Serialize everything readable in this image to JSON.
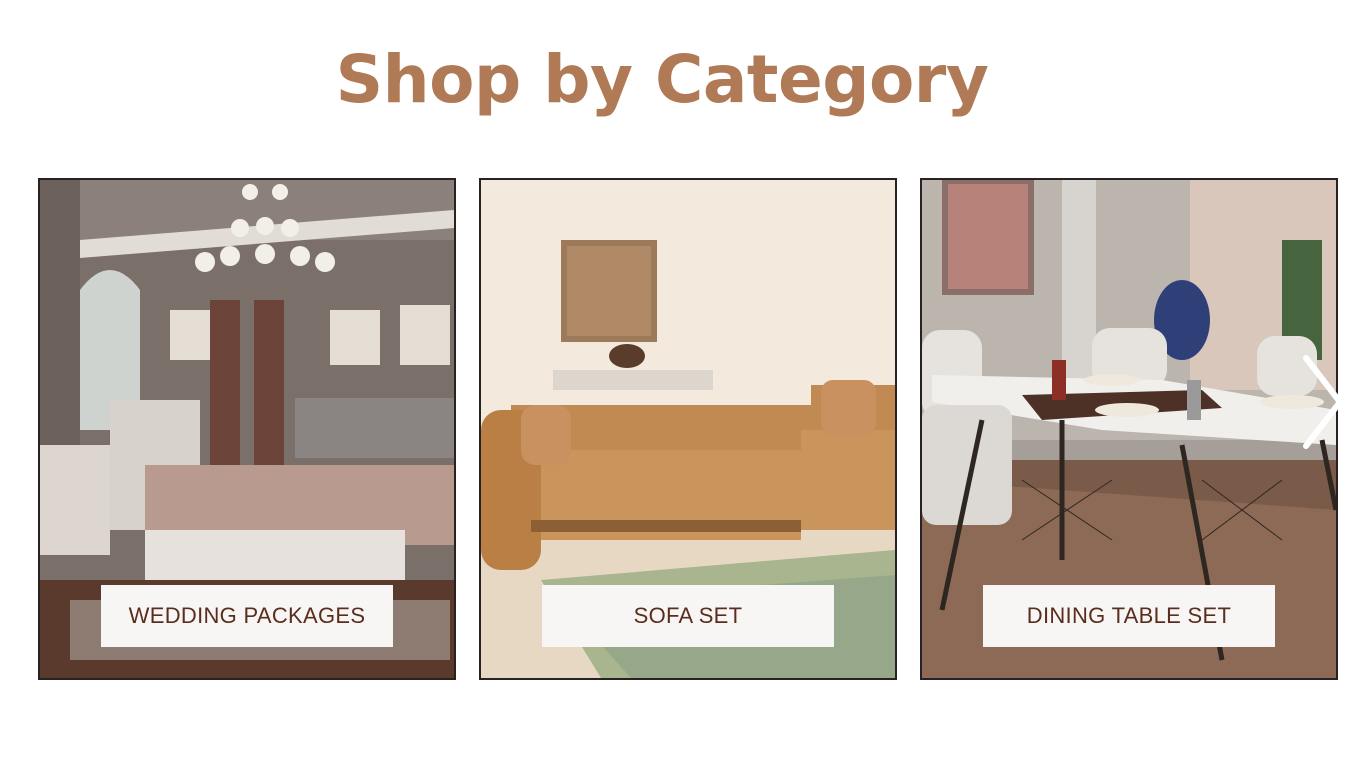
{
  "heading": {
    "title": "Shop by Category",
    "color": "#b07a56"
  },
  "categories": [
    {
      "label": "WEDDING PACKAGES",
      "image": "bedroom-set-photo"
    },
    {
      "label": "SOFA SET",
      "image": "sofa-set-photo"
    },
    {
      "label": "DINING TABLE SET",
      "image": "dining-table-photo"
    }
  ],
  "carousel": {
    "next_icon": "chevron-right-icon"
  },
  "colors": {
    "label_text": "#5a2e1e",
    "label_bg": "#f8f6f4",
    "card_border": "#2a2222"
  }
}
